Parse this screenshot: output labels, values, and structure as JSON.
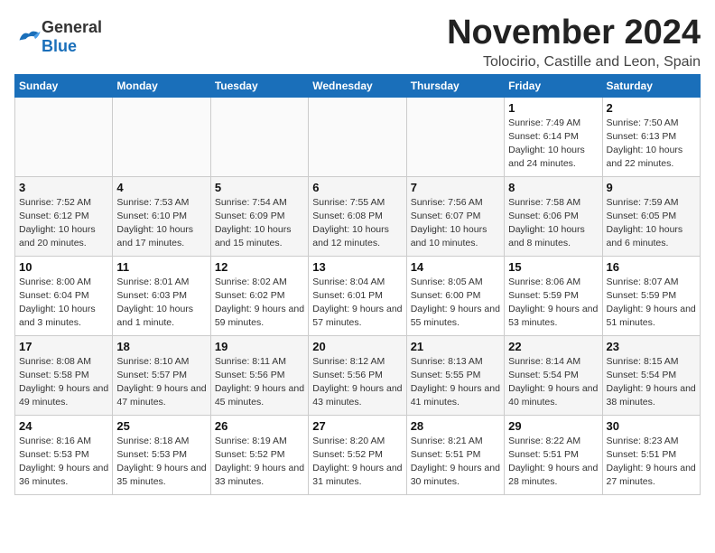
{
  "header": {
    "logo_general": "General",
    "logo_blue": "Blue",
    "month_title": "November 2024",
    "location": "Tolocirio, Castille and Leon, Spain"
  },
  "days_of_week": [
    "Sunday",
    "Monday",
    "Tuesday",
    "Wednesday",
    "Thursday",
    "Friday",
    "Saturday"
  ],
  "weeks": [
    [
      {
        "day": "",
        "info": ""
      },
      {
        "day": "",
        "info": ""
      },
      {
        "day": "",
        "info": ""
      },
      {
        "day": "",
        "info": ""
      },
      {
        "day": "",
        "info": ""
      },
      {
        "day": "1",
        "info": "Sunrise: 7:49 AM\nSunset: 6:14 PM\nDaylight: 10 hours and 24 minutes."
      },
      {
        "day": "2",
        "info": "Sunrise: 7:50 AM\nSunset: 6:13 PM\nDaylight: 10 hours and 22 minutes."
      }
    ],
    [
      {
        "day": "3",
        "info": "Sunrise: 7:52 AM\nSunset: 6:12 PM\nDaylight: 10 hours and 20 minutes."
      },
      {
        "day": "4",
        "info": "Sunrise: 7:53 AM\nSunset: 6:10 PM\nDaylight: 10 hours and 17 minutes."
      },
      {
        "day": "5",
        "info": "Sunrise: 7:54 AM\nSunset: 6:09 PM\nDaylight: 10 hours and 15 minutes."
      },
      {
        "day": "6",
        "info": "Sunrise: 7:55 AM\nSunset: 6:08 PM\nDaylight: 10 hours and 12 minutes."
      },
      {
        "day": "7",
        "info": "Sunrise: 7:56 AM\nSunset: 6:07 PM\nDaylight: 10 hours and 10 minutes."
      },
      {
        "day": "8",
        "info": "Sunrise: 7:58 AM\nSunset: 6:06 PM\nDaylight: 10 hours and 8 minutes."
      },
      {
        "day": "9",
        "info": "Sunrise: 7:59 AM\nSunset: 6:05 PM\nDaylight: 10 hours and 6 minutes."
      }
    ],
    [
      {
        "day": "10",
        "info": "Sunrise: 8:00 AM\nSunset: 6:04 PM\nDaylight: 10 hours and 3 minutes."
      },
      {
        "day": "11",
        "info": "Sunrise: 8:01 AM\nSunset: 6:03 PM\nDaylight: 10 hours and 1 minute."
      },
      {
        "day": "12",
        "info": "Sunrise: 8:02 AM\nSunset: 6:02 PM\nDaylight: 9 hours and 59 minutes."
      },
      {
        "day": "13",
        "info": "Sunrise: 8:04 AM\nSunset: 6:01 PM\nDaylight: 9 hours and 57 minutes."
      },
      {
        "day": "14",
        "info": "Sunrise: 8:05 AM\nSunset: 6:00 PM\nDaylight: 9 hours and 55 minutes."
      },
      {
        "day": "15",
        "info": "Sunrise: 8:06 AM\nSunset: 5:59 PM\nDaylight: 9 hours and 53 minutes."
      },
      {
        "day": "16",
        "info": "Sunrise: 8:07 AM\nSunset: 5:59 PM\nDaylight: 9 hours and 51 minutes."
      }
    ],
    [
      {
        "day": "17",
        "info": "Sunrise: 8:08 AM\nSunset: 5:58 PM\nDaylight: 9 hours and 49 minutes."
      },
      {
        "day": "18",
        "info": "Sunrise: 8:10 AM\nSunset: 5:57 PM\nDaylight: 9 hours and 47 minutes."
      },
      {
        "day": "19",
        "info": "Sunrise: 8:11 AM\nSunset: 5:56 PM\nDaylight: 9 hours and 45 minutes."
      },
      {
        "day": "20",
        "info": "Sunrise: 8:12 AM\nSunset: 5:56 PM\nDaylight: 9 hours and 43 minutes."
      },
      {
        "day": "21",
        "info": "Sunrise: 8:13 AM\nSunset: 5:55 PM\nDaylight: 9 hours and 41 minutes."
      },
      {
        "day": "22",
        "info": "Sunrise: 8:14 AM\nSunset: 5:54 PM\nDaylight: 9 hours and 40 minutes."
      },
      {
        "day": "23",
        "info": "Sunrise: 8:15 AM\nSunset: 5:54 PM\nDaylight: 9 hours and 38 minutes."
      }
    ],
    [
      {
        "day": "24",
        "info": "Sunrise: 8:16 AM\nSunset: 5:53 PM\nDaylight: 9 hours and 36 minutes."
      },
      {
        "day": "25",
        "info": "Sunrise: 8:18 AM\nSunset: 5:53 PM\nDaylight: 9 hours and 35 minutes."
      },
      {
        "day": "26",
        "info": "Sunrise: 8:19 AM\nSunset: 5:52 PM\nDaylight: 9 hours and 33 minutes."
      },
      {
        "day": "27",
        "info": "Sunrise: 8:20 AM\nSunset: 5:52 PM\nDaylight: 9 hours and 31 minutes."
      },
      {
        "day": "28",
        "info": "Sunrise: 8:21 AM\nSunset: 5:51 PM\nDaylight: 9 hours and 30 minutes."
      },
      {
        "day": "29",
        "info": "Sunrise: 8:22 AM\nSunset: 5:51 PM\nDaylight: 9 hours and 28 minutes."
      },
      {
        "day": "30",
        "info": "Sunrise: 8:23 AM\nSunset: 5:51 PM\nDaylight: 9 hours and 27 minutes."
      }
    ]
  ]
}
